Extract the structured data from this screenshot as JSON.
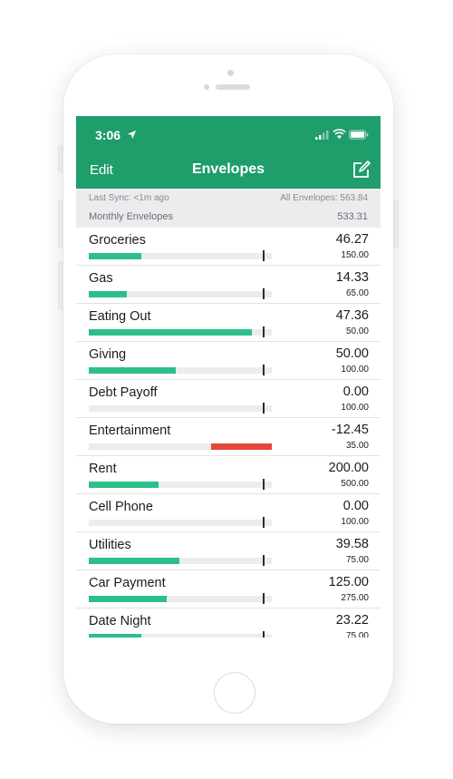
{
  "colors": {
    "brand_green": "#1f9d6b",
    "bar_green": "#2dbf88",
    "bar_red": "#e5463b",
    "track_gray": "#ececef"
  },
  "status_bar": {
    "time": "3:06",
    "icons": [
      "location-arrow-icon",
      "cellular-signal-icon",
      "wifi-icon",
      "battery-icon"
    ]
  },
  "nav": {
    "edit_label": "Edit",
    "title": "Envelopes",
    "compose_icon": "compose-icon"
  },
  "summary": {
    "last_sync": "Last Sync: <1m ago",
    "all_envelopes": "All Envelopes: 563.84",
    "section_label": "Monthly Envelopes",
    "section_total": "533.31"
  },
  "envelopes": [
    {
      "name": "Groceries",
      "amount": "46.27",
      "budget": "150.00",
      "fill": 0.3
    },
    {
      "name": "Gas",
      "amount": "14.33",
      "budget": "65.00",
      "fill": 0.22
    },
    {
      "name": "Eating Out",
      "amount": "47.36",
      "budget": "50.00",
      "fill": 0.94
    },
    {
      "name": "Giving",
      "amount": "50.00",
      "budget": "100.00",
      "fill": 0.5
    },
    {
      "name": "Debt Payoff",
      "amount": "0.00",
      "budget": "100.00",
      "fill": 0
    },
    {
      "name": "Entertainment",
      "amount": "-12.45",
      "budget": "35.00",
      "fill": -0.35
    },
    {
      "name": "Rent",
      "amount": "200.00",
      "budget": "500.00",
      "fill": 0.4
    },
    {
      "name": "Cell Phone",
      "amount": "0.00",
      "budget": "100.00",
      "fill": 0
    },
    {
      "name": "Utilities",
      "amount": "39.58",
      "budget": "75.00",
      "fill": 0.52
    },
    {
      "name": "Car Payment",
      "amount": "125.00",
      "budget": "275.00",
      "fill": 0.45
    },
    {
      "name": "Date Night",
      "amount": "23.22",
      "budget": "75.00",
      "fill": 0.3
    }
  ]
}
